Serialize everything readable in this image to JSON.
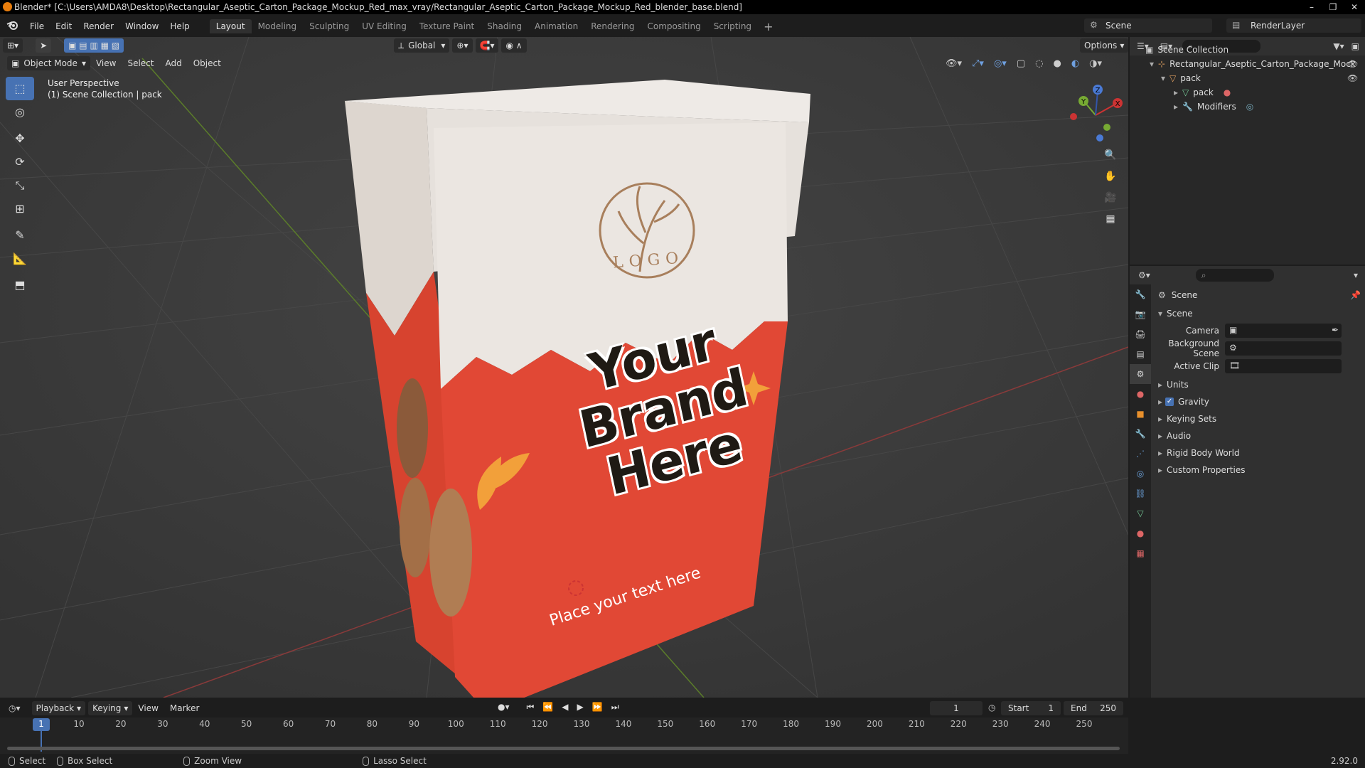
{
  "window": {
    "title": "Blender* [C:\\Users\\AMDA8\\Desktop\\Rectangular_Aseptic_Carton_Package_Mockup_Red_max_vray/Rectangular_Aseptic_Carton_Package_Mockup_Red_blender_base.blend]",
    "minimize": "–",
    "maximize": "❐",
    "close": "✕"
  },
  "menu": [
    "File",
    "Edit",
    "Render",
    "Window",
    "Help"
  ],
  "workspaces": [
    "Layout",
    "Modeling",
    "Sculpting",
    "UV Editing",
    "Texture Paint",
    "Shading",
    "Animation",
    "Rendering",
    "Compositing",
    "Scripting"
  ],
  "workspace_add": "+",
  "scene_name": "Scene",
  "render_layer": "RenderLayer",
  "viewport": {
    "mode": "Object Mode",
    "menus": [
      "View",
      "Select",
      "Add",
      "Object"
    ],
    "transform_orientation": "Global",
    "options": "Options",
    "info_line1": "User Perspective",
    "info_line2": "(1) Scene Collection | pack",
    "carton": {
      "logo_text": "LOGO",
      "headline": [
        "Your",
        "Brand",
        "Here"
      ],
      "tagline": "Place your text here"
    },
    "gizmo_axes": {
      "x": "X",
      "y": "Y",
      "z": "Z"
    }
  },
  "outliner": {
    "root": "Scene Collection",
    "items": [
      {
        "label": "Rectangular_Aseptic_Carton_Package_Mock"
      },
      {
        "label": "pack"
      },
      {
        "label": "pack"
      },
      {
        "label": "Modifiers"
      }
    ]
  },
  "properties": {
    "context": "Scene",
    "panel_title": "Scene",
    "fields": [
      {
        "label": "Camera"
      },
      {
        "label": "Background Scene"
      },
      {
        "label": "Active Clip"
      }
    ],
    "panels": [
      "Units",
      "Gravity",
      "Keying Sets",
      "Audio",
      "Rigid Body World",
      "Custom Properties"
    ],
    "gravity_checked": true
  },
  "timeline": {
    "menus": [
      "Playback",
      "Keying",
      "View",
      "Marker"
    ],
    "current_frame": "1",
    "start_label": "Start",
    "start": "1",
    "end_label": "End",
    "end": "250",
    "ticks": [
      "1",
      "10",
      "20",
      "30",
      "40",
      "50",
      "60",
      "70",
      "80",
      "90",
      "100",
      "110",
      "120",
      "130",
      "140",
      "150",
      "160",
      "170",
      "180",
      "190",
      "200",
      "210",
      "220",
      "230",
      "240",
      "250"
    ]
  },
  "statusbar": {
    "items": [
      "Select",
      "Box Select",
      "Zoom View",
      "Lasso Select"
    ],
    "version": "2.92.0"
  }
}
